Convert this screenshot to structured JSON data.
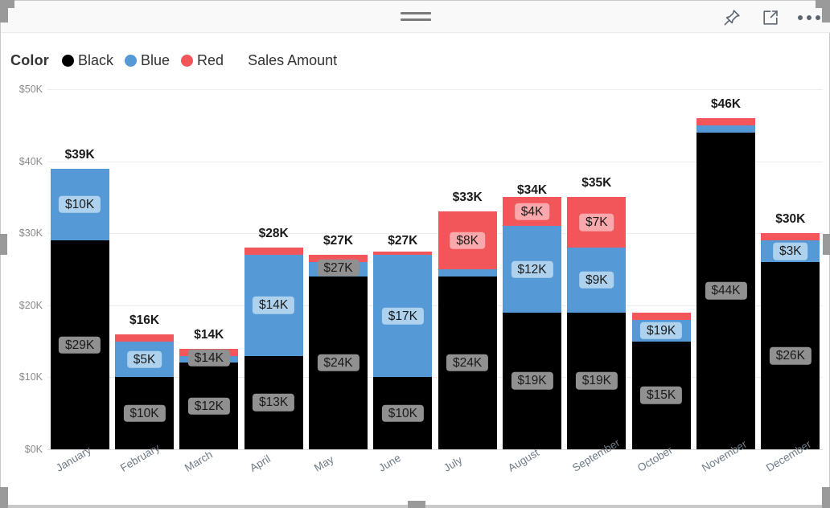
{
  "window": {
    "drag_handle": "drag-handle",
    "tools": [
      {
        "name": "pin-icon",
        "label": "Pin to dashboard"
      },
      {
        "name": "focus-mode-icon",
        "label": "Focus mode"
      },
      {
        "name": "more-options-icon",
        "label": "More options"
      }
    ]
  },
  "legend": {
    "title": "Color",
    "items": [
      {
        "label": "Black",
        "color": "#000000"
      },
      {
        "label": "Blue",
        "color": "#5599D6"
      },
      {
        "label": "Red",
        "color": "#F2555A"
      }
    ],
    "measure": "Sales Amount"
  },
  "chart_data": {
    "type": "bar",
    "subtype": "stacked-column",
    "title": "Sales Amount",
    "xlabel": "",
    "ylabel": "",
    "ylim": [
      0,
      50000
    ],
    "ytick_labels": [
      "$50K",
      "$40K",
      "$30K",
      "$20K",
      "$10K",
      "$0K"
    ],
    "ytick_values": [
      50000,
      40000,
      30000,
      20000,
      10000,
      0
    ],
    "grid": true,
    "legend_position": "top-left",
    "categories": [
      "January",
      "February",
      "March",
      "April",
      "May",
      "June",
      "July",
      "August",
      "September",
      "October",
      "November",
      "December"
    ],
    "series": [
      {
        "name": "Black",
        "color": "#000000",
        "values": [
          29000,
          10000,
          12000,
          13000,
          24000,
          10000,
          24000,
          19000,
          19000,
          15000,
          44000,
          26000
        ]
      },
      {
        "name": "Blue",
        "color": "#5599D6",
        "values": [
          10000,
          5000,
          1000,
          14000,
          2000,
          17000,
          1000,
          12000,
          9000,
          3000,
          1000,
          3000
        ]
      },
      {
        "name": "Red",
        "color": "#F2555A",
        "values": [
          0,
          1000,
          1000,
          1000,
          1000,
          500,
          8000,
          4000,
          7000,
          1000,
          1000,
          1000
        ]
      }
    ],
    "totals": [
      39000,
      16000,
      14000,
      28000,
      27000,
      27000,
      33000,
      34000,
      35000,
      19000,
      46000,
      30000
    ],
    "total_labels": [
      "$39K",
      "$16K",
      "$14K",
      "$28K",
      "$27K",
      "$27K",
      "$33K",
      "$34K",
      "$35K",
      "",
      "$46K",
      "$30K"
    ],
    "bar_labels": [
      {
        "category": "January",
        "black": "$29K",
        "blue": "$10K",
        "red": ""
      },
      {
        "category": "February",
        "black": "$10K",
        "blue": "$5K",
        "red": ""
      },
      {
        "category": "March",
        "black": "$12K",
        "blue": "",
        "red": "",
        "top_overlay": "$14K"
      },
      {
        "category": "April",
        "black": "$13K",
        "blue": "$14K",
        "red": ""
      },
      {
        "category": "May",
        "black": "$24K",
        "blue": "",
        "red": "",
        "top_overlay": "$27K"
      },
      {
        "category": "June",
        "black": "$10K",
        "blue": "$17K",
        "red": ""
      },
      {
        "category": "July",
        "black": "$24K",
        "blue": "",
        "red": "$8K"
      },
      {
        "category": "August",
        "black": "$19K",
        "blue": "$12K",
        "red": "$4K"
      },
      {
        "category": "September",
        "black": "$19K",
        "blue": "$9K",
        "red": "$7K"
      },
      {
        "category": "October",
        "black": "$15K",
        "blue": "$19K",
        "red": ""
      },
      {
        "category": "November",
        "black": "$44K",
        "blue": "",
        "red": ""
      },
      {
        "category": "December",
        "black": "$26K",
        "blue": "$3K",
        "red": ""
      }
    ]
  }
}
